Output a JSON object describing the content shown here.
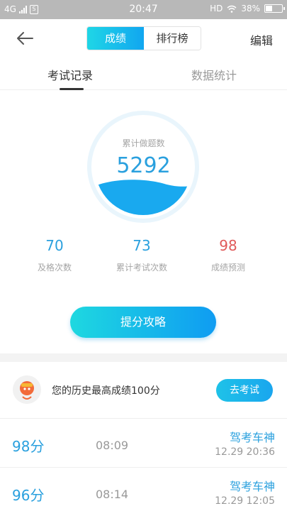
{
  "status_bar": {
    "network": "4G",
    "sim": "S",
    "time": "20:47",
    "hd": "HD",
    "battery": "38%"
  },
  "nav": {
    "segments": [
      "成绩",
      "排行榜"
    ],
    "active_segment": "成绩",
    "edit_label": "编辑"
  },
  "tabs": [
    "考试记录",
    "数据统计"
  ],
  "summary": {
    "circle_label": "累计做题数",
    "total": "5292"
  },
  "stats": [
    {
      "value": "70",
      "label": "及格次数"
    },
    {
      "value": "73",
      "label": "累计考试次数"
    },
    {
      "value": "98",
      "label": "成绩预测"
    }
  ],
  "cta_label": "提分攻略",
  "best": {
    "text": "您的历史最高成绩100分",
    "button": "去考试"
  },
  "records": [
    {
      "score": "98分",
      "duration": "08:09",
      "brand": "驾考车神",
      "date": "12.29  20:36"
    },
    {
      "score": "96分",
      "duration": "08:14",
      "brand": "驾考车神",
      "date": "12.29  12:05"
    }
  ],
  "colors": {
    "accent": "#2aa0de",
    "accent_gradient_start": "#1ed8e0",
    "warn": "#e05a5a"
  }
}
